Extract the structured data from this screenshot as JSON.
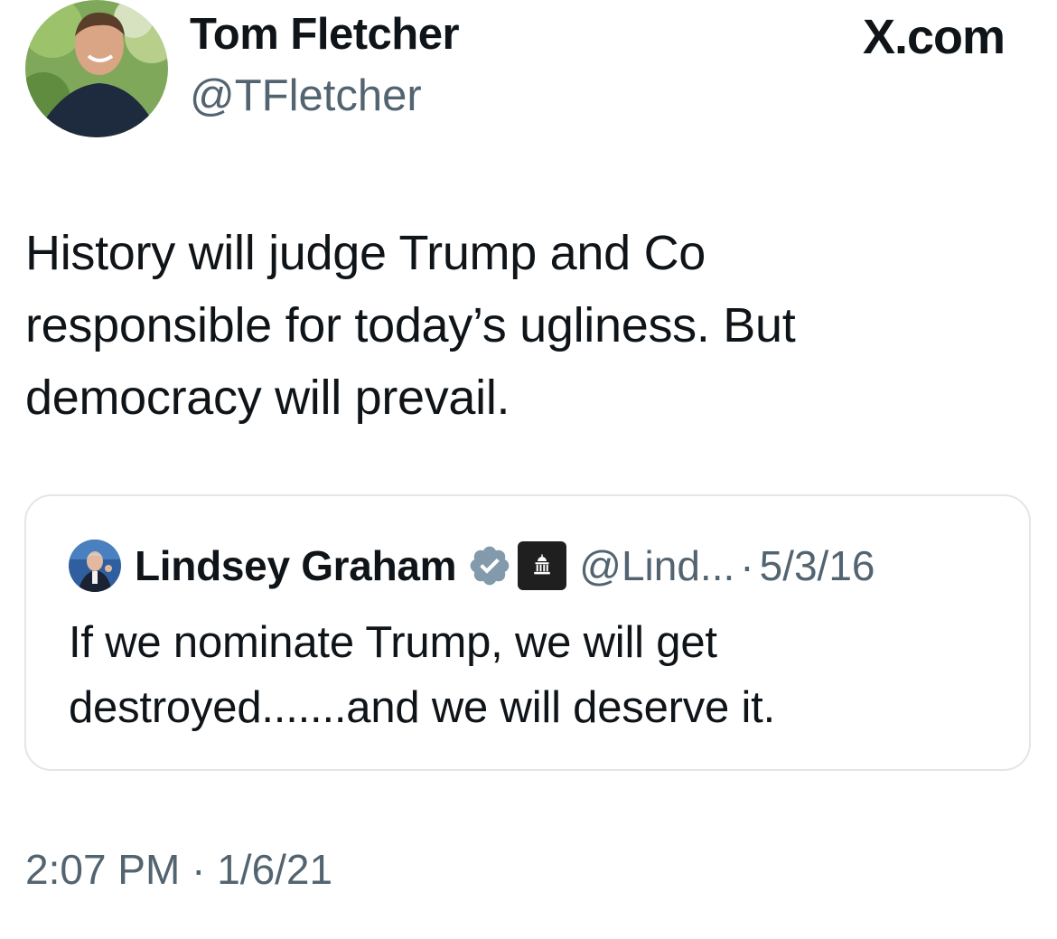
{
  "author": {
    "name": "Tom Fletcher",
    "handle": "@TFletcher",
    "avatar_icon": "profile-photo"
  },
  "site_label": "X.com",
  "tweet": {
    "text_lines": [
      "History will judge Trump and Co",
      "responsible for today’s ugliness. But",
      "democracy will prevail."
    ]
  },
  "quoted_tweet": {
    "author_name": "Lindsey Graham",
    "verified_icon": "verified-badge-icon",
    "badge_icon": "government-building-icon",
    "handle": "@Lind...",
    "separator": "·",
    "date": "5/3/16",
    "text_lines": [
      "If we nominate Trump, we will get",
      "destroyed.......and we will deserve it."
    ]
  },
  "timestamp": {
    "time": "2:07 PM",
    "separator": "·",
    "date": "1/6/21"
  },
  "colors": {
    "text": "#0f1419",
    "muted": "#536471",
    "verified_gray": "#829aab",
    "border": "#e3e6e8"
  }
}
